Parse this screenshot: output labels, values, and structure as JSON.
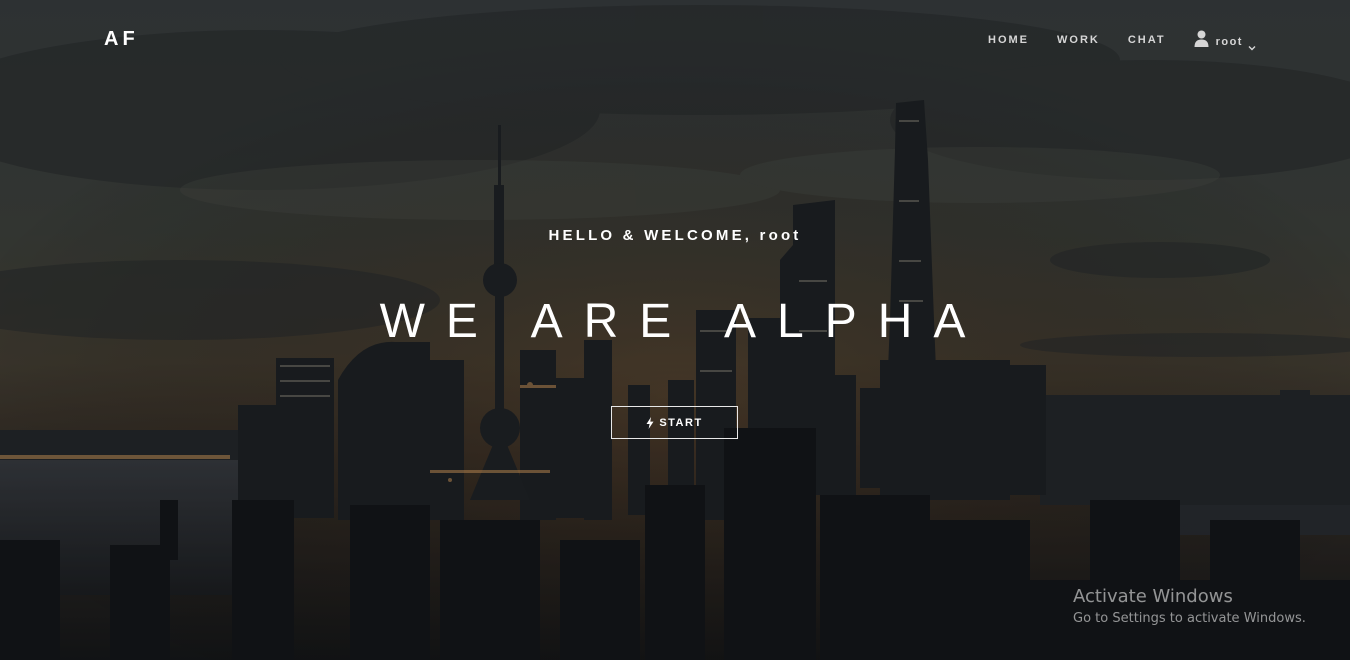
{
  "nav": {
    "brand": "AF",
    "links": [
      "HOME",
      "WORK",
      "CHAT"
    ],
    "user": {
      "name": "root",
      "icon": "user-icon",
      "dropdown_icon": "chevron-down-icon"
    }
  },
  "hero": {
    "greeting": "HELLO & WELCOME,",
    "username": "root",
    "headline": "WE ARE ALPHA",
    "cta": {
      "label": "START",
      "icon": "bolt-icon"
    },
    "background": "night-city-skyline"
  },
  "watermark": {
    "title": "Activate Windows",
    "subtitle": "Go to Settings to activate Windows."
  },
  "colors": {
    "text": "#ffffff",
    "nav_text": "#d6d6d6",
    "overlay": "#1c2024"
  }
}
